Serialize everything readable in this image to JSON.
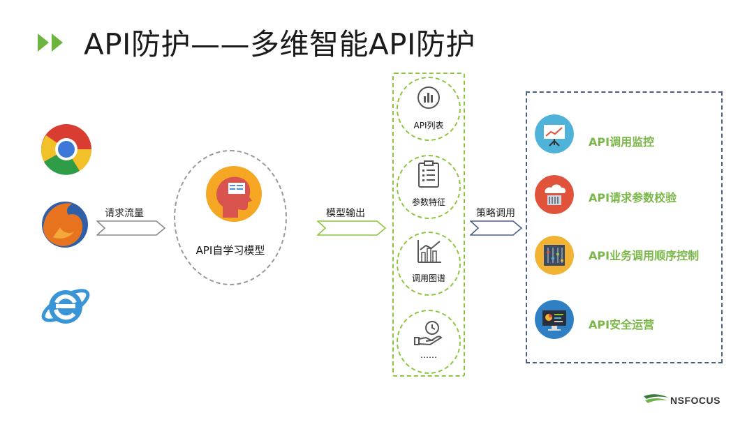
{
  "title": "API防护——多维智能API防护",
  "flow": {
    "input_label": "请求流量",
    "core_label": "API自学习模型",
    "model_output_label": "模型输出",
    "strategy_label": "策略调用"
  },
  "browsers": [
    "chrome-icon",
    "firefox-icon",
    "ie-icon"
  ],
  "model_outputs": [
    {
      "label": "API列表",
      "icon": "bar-chart-icon"
    },
    {
      "label": "参数特征",
      "icon": "clipboard-icon"
    },
    {
      "label": "调用图谱",
      "icon": "trend-chart-icon"
    },
    {
      "label": "……",
      "icon": "hand-clock-icon"
    }
  ],
  "strategies": [
    {
      "label": "API调用监控",
      "icon": "presentation-board-icon",
      "color": "#4fb3d9"
    },
    {
      "label": "API请求参数校验",
      "icon": "cloud-server-icon",
      "color": "#e0533a"
    },
    {
      "label": "API业务调用顺序控制",
      "icon": "sliders-icon",
      "color": "#f2b233"
    },
    {
      "label": "API安全运营",
      "icon": "monitor-icon",
      "color": "#2f7fc4"
    }
  ],
  "colors": {
    "green": "#8cc63f",
    "label_green": "#7ab648",
    "navy": "#4a5d86"
  },
  "brand": "NSFOCUS"
}
